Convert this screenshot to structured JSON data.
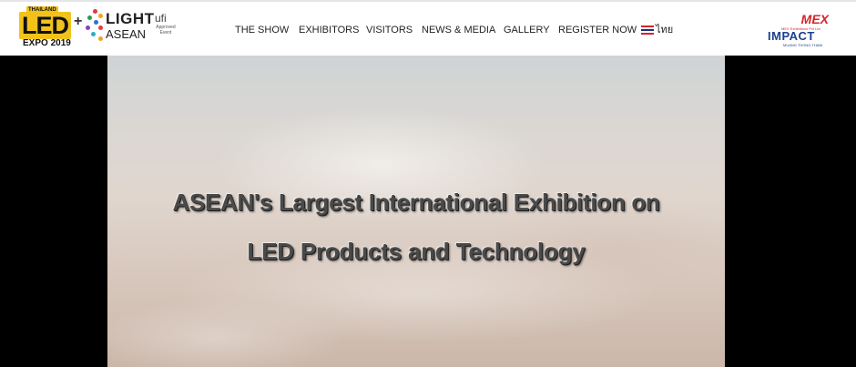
{
  "brand": {
    "led_tag": "THAILAND",
    "led_word": "LED",
    "led_expo": "EXPO 2019",
    "plus": "+",
    "light_word": "LIGHT",
    "asean_word": "ASEAN",
    "ufi_word": "ufi",
    "ufi_sub": "Approved Event",
    "mex_word": "MEX",
    "mex_sub": "MEX Exhibitions Pvt Ltd",
    "impact_word": "IMPACT",
    "impact_sub": "MUANG THONG THANI"
  },
  "nav": {
    "items": [
      {
        "label": "THE SHOW"
      },
      {
        "label": "EXHIBITORS"
      },
      {
        "label": "VISITORS"
      },
      {
        "label": "NEWS & MEDIA"
      },
      {
        "label": "GALLERY"
      },
      {
        "label": "REGISTER NOW"
      }
    ],
    "language": "ไทย",
    "language_flag_icon": "thailand-flag-icon"
  },
  "hero": {
    "line1": "ASEAN's Largest International Exhibition on",
    "line2": "LED Products and Technology"
  },
  "colors": {
    "led_yellow": "#f2c21b",
    "mex_red": "#d6232a",
    "impact_blue": "#1d3f8f",
    "text_dark": "#222222"
  }
}
